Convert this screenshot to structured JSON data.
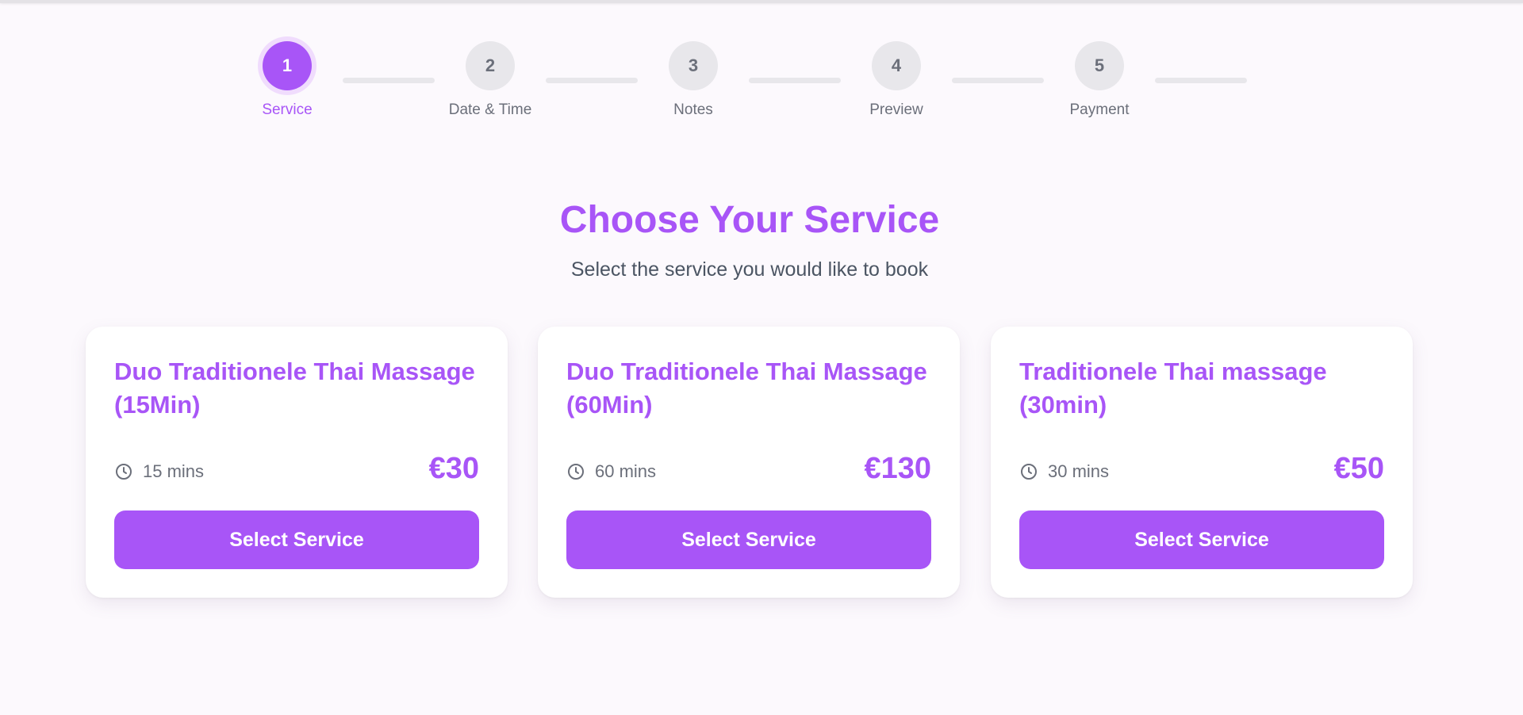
{
  "stepper": {
    "steps": [
      {
        "number": "1",
        "label": "Service",
        "active": true
      },
      {
        "number": "2",
        "label": "Date & Time",
        "active": false
      },
      {
        "number": "3",
        "label": "Notes",
        "active": false
      },
      {
        "number": "4",
        "label": "Preview",
        "active": false
      },
      {
        "number": "5",
        "label": "Payment",
        "active": false
      }
    ]
  },
  "main": {
    "title": "Choose Your Service",
    "subtitle": "Select the service you would like to book"
  },
  "services": [
    {
      "name": "Duo Traditionele Thai Massage (15Min)",
      "duration": "15 mins",
      "price": "€30",
      "button_label": "Select Service"
    },
    {
      "name": "Duo Traditionele Thai Massage (60Min)",
      "duration": "60 mins",
      "price": "€130",
      "button_label": "Select Service"
    },
    {
      "name": "Traditionele Thai massage (30min)",
      "duration": "30 mins",
      "price": "€50",
      "button_label": "Select Service"
    }
  ],
  "icons": {
    "duration": "clock-icon"
  },
  "colors": {
    "accent": "#a855f7",
    "accent_ring": "#f0dcfd",
    "inactive_step": "#e8e7eb",
    "muted_text": "#6b6f7a",
    "background": "#fcf9fd"
  }
}
